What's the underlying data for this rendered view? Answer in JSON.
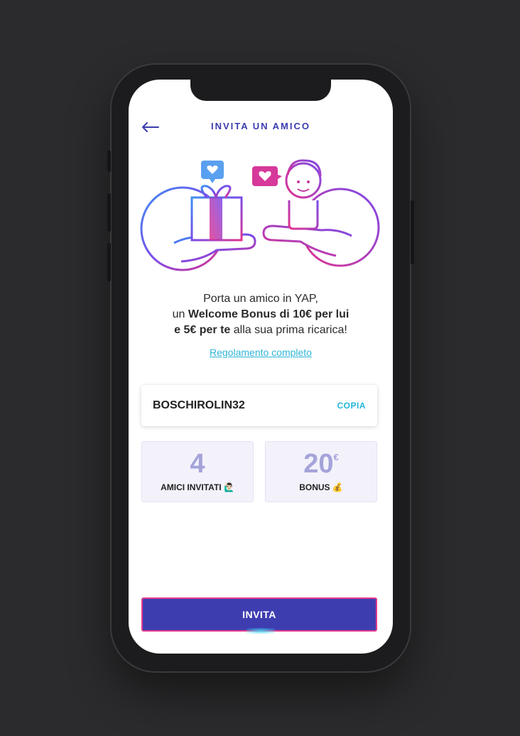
{
  "header": {
    "title": "INVITA UN AMICO",
    "back_icon": "arrow-left-icon"
  },
  "promo": {
    "line1": "Porta un amico in YAP,",
    "line2_prefix": "un ",
    "line2_bold": "Welcome Bonus di 10€ per lui",
    "line3_bold": "e 5€ per te",
    "line3_suffix": " alla sua prima ricarica!"
  },
  "rules_link": "Regolamento completo",
  "code_card": {
    "code": "BOSCHIROLIN32",
    "copy_label": "COPIA"
  },
  "stats": [
    {
      "value": "4",
      "label": "AMICI INVITATI 🙋🏻‍♂️"
    },
    {
      "value": "20",
      "unit": "€",
      "label": "BONUS 💰"
    }
  ],
  "invite_button": "INVITA",
  "colors": {
    "accent": "#3e3db0",
    "link": "#2fb5d6",
    "pink": "#e23a8e",
    "stat_number": "#a4a3d9"
  }
}
